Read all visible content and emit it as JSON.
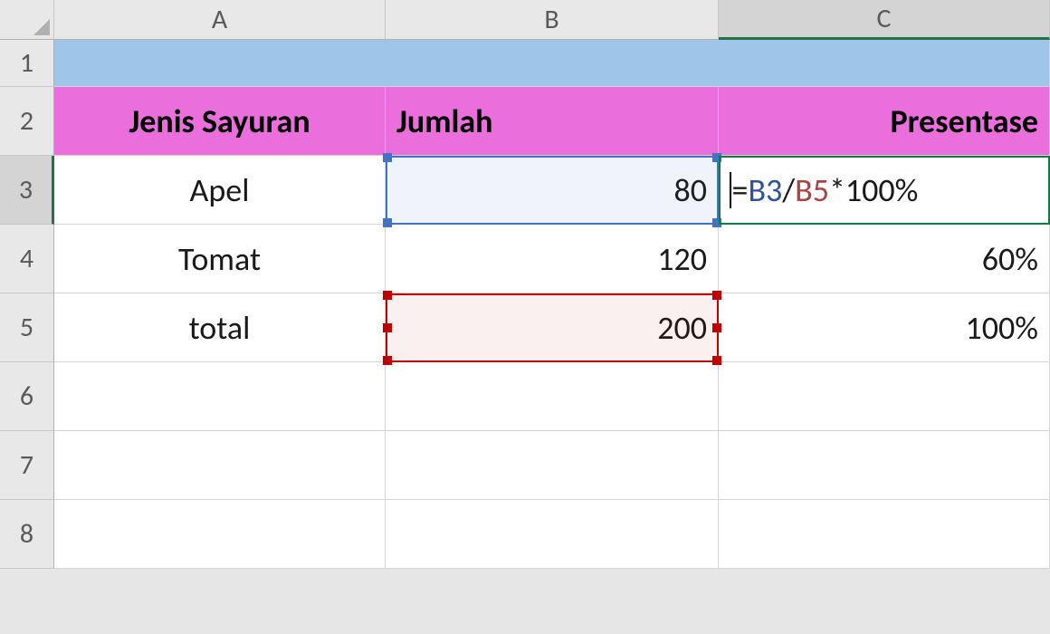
{
  "columns": {
    "A": "A",
    "B": "B",
    "C": "C"
  },
  "rows": {
    "r1": "1",
    "r2": "2",
    "r3": "3",
    "r4": "4",
    "r5": "5",
    "r6": "6",
    "r7": "7",
    "r8": "8"
  },
  "headers": {
    "colA": "Jenis Sayuran",
    "colB": "Jumlah",
    "colC": "Presentase"
  },
  "data": {
    "A3": "Apel",
    "A4": "Tomat",
    "A5": "total",
    "B3": "80",
    "B4": "120",
    "B5": "200",
    "C4": "60%",
    "C5": "100%"
  },
  "formula": {
    "eq": "=",
    "ref1": "B3",
    "slash": "/",
    "ref2": "B5",
    "tail": "*100%"
  },
  "active_cell": "C3",
  "referenced_ranges": [
    "B3",
    "B5"
  ],
  "colors": {
    "row1_fill": "#9fc5e8",
    "header_fill": "#ea6fdc",
    "ref1_border": "#4472c4",
    "ref2_border": "#c00000",
    "active_border": "#107c41"
  }
}
